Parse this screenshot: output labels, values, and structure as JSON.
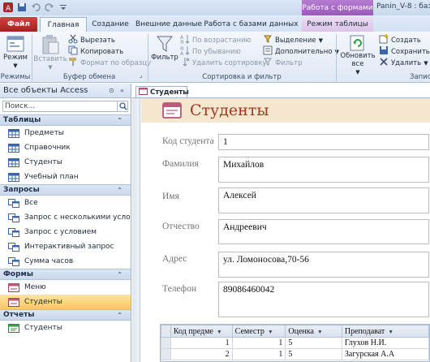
{
  "window": {
    "app_title": "Panin_V-8 : баз",
    "context_title": "Работа с формами"
  },
  "tabs": [
    {
      "label": "Файл"
    },
    {
      "label": "Главная"
    },
    {
      "label": "Создание"
    },
    {
      "label": "Внешние данные"
    },
    {
      "label": "Работа с базами данных"
    },
    {
      "label": "Режим таблицы"
    }
  ],
  "ribbon": {
    "views": {
      "mode_label": "Режим",
      "group": "Режимы"
    },
    "clipboard": {
      "paste": "Вставить",
      "cut": "Вырезать",
      "copy": "Копировать",
      "format_painter": "Формат по образцу",
      "group": "Буфер обмена"
    },
    "sort_filter": {
      "filter": "Фильтр",
      "ascending": "По возрастанию",
      "descending": "По убыванию",
      "remove_sort": "Удалить сортировку",
      "selection": "Выделение",
      "advanced": "Дополнительно",
      "toggle_filter": "Фильтр",
      "group": "Сортировка и фильтр"
    },
    "records": {
      "refresh_all": "Обновить все",
      "new": "Создать",
      "save": "Сохранить",
      "delete": "Удалить",
      "group": "Запис"
    }
  },
  "nav": {
    "header": "Все объекты Access",
    "search_placeholder": "Поиск...",
    "sections": [
      {
        "title": "Таблицы",
        "items": [
          "Предметы",
          "Справочник",
          "Студенты",
          "Учебный план"
        ]
      },
      {
        "title": "Запросы",
        "items": [
          "Все",
          "Запрос с несколькими услов...",
          "Запрос с условием",
          "Интерактивный запрос",
          "Сумма часов"
        ]
      },
      {
        "title": "Формы",
        "items": [
          "Меню",
          "Студенты"
        ]
      },
      {
        "title": "Отчеты",
        "items": [
          "Студенты"
        ]
      }
    ]
  },
  "document": {
    "tab_label": "Студенты",
    "form_title": "Студенты",
    "fields": [
      {
        "label": "Код студента",
        "value": "1"
      },
      {
        "label": "Фамилия",
        "value": "Михайлов"
      },
      {
        "label": "Имя",
        "value": "Алексей"
      },
      {
        "label": "Отчество",
        "value": "Андреевич"
      },
      {
        "label": "Адрес",
        "value": "ул. Ломоносова,70-56"
      },
      {
        "label": "Телефон",
        "value": "89086460042"
      }
    ],
    "subform": {
      "columns": [
        "Код предме",
        "Семестр",
        "Оценка",
        "Преподават"
      ],
      "rows": [
        [
          "1",
          "1",
          "5",
          "Глухов Н.И."
        ],
        [
          "2",
          "1",
          "5",
          "Загурская А.А"
        ]
      ]
    }
  },
  "colors": {
    "file_tab": "#c1302f",
    "context_tab": "#9a59be",
    "form_title": "#a0381e",
    "selected_nav": "#f9c865"
  }
}
